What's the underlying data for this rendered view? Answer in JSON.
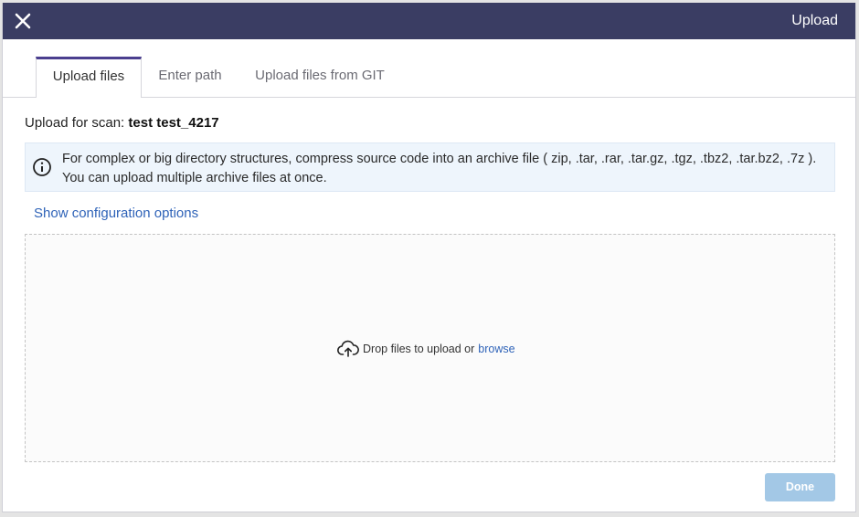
{
  "dialog": {
    "title": "Upload",
    "close_icon": "close-icon"
  },
  "tabs": [
    {
      "label": "Upload files",
      "active": true
    },
    {
      "label": "Enter path",
      "active": false
    },
    {
      "label": "Upload files from GIT",
      "active": false
    }
  ],
  "scan": {
    "label": "Upload for scan:",
    "name": "test test_4217"
  },
  "info": {
    "icon": "info-icon",
    "line1": "For complex or big directory structures, compress source code into an archive file ( zip, .tar, .rar, .tar.gz, .tgz, .tbz2, .tar.bz2, .7z ).",
    "line2": "You can upload multiple archive files at once."
  },
  "config_link": "Show configuration options",
  "dropzone": {
    "icon": "cloud-upload-icon",
    "text": "Drop files to upload or",
    "browse": "browse"
  },
  "footer": {
    "done_label": "Done"
  },
  "colors": {
    "titlebar": "#3a3d63",
    "active_tab_accent": "#4b3f8f",
    "link": "#2f63b8",
    "info_bg": "#eef5fc",
    "done_disabled": "#a3c8e6"
  }
}
